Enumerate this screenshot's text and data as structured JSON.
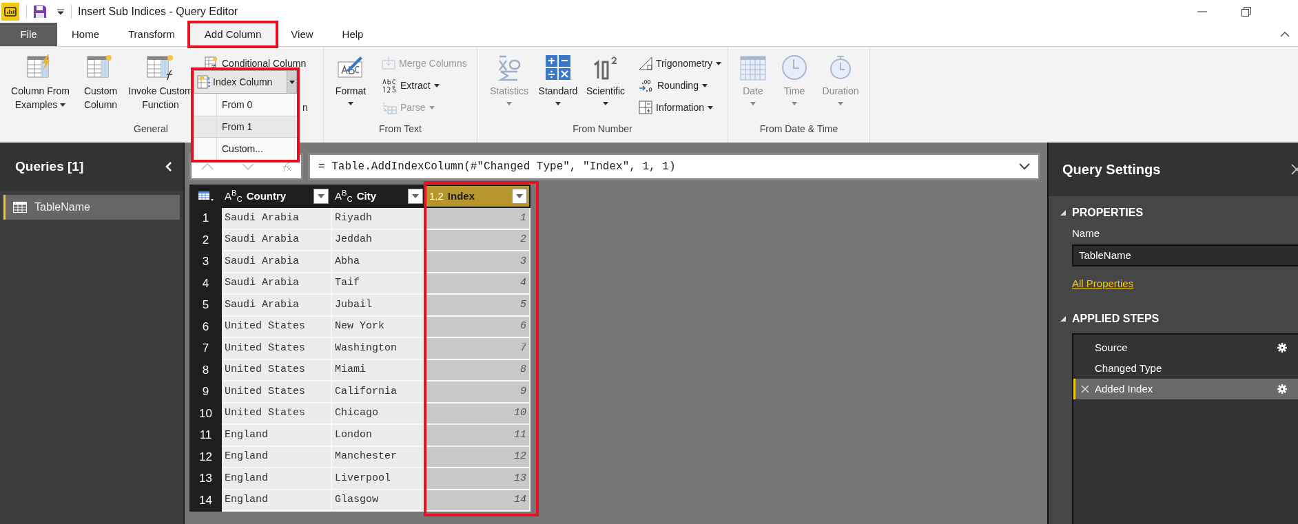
{
  "window": {
    "title": "Insert Sub Indices - Query Editor"
  },
  "tabs": [
    {
      "label": "File",
      "kind": "file",
      "selected": false,
      "highlighted": false
    },
    {
      "label": "Home",
      "kind": "tab",
      "selected": false,
      "highlighted": false
    },
    {
      "label": "Transform",
      "kind": "tab",
      "selected": false,
      "highlighted": false
    },
    {
      "label": "Add Column",
      "kind": "tab",
      "selected": true,
      "highlighted": true
    },
    {
      "label": "View",
      "kind": "tab",
      "selected": false,
      "highlighted": false
    },
    {
      "label": "Help",
      "kind": "tab",
      "selected": false,
      "highlighted": false
    }
  ],
  "ribbon_groups": [
    {
      "label": "General",
      "items": [
        {
          "kind": "large",
          "lines": [
            "Column From",
            "Examples"
          ],
          "dropdown": true,
          "disabled": false
        },
        {
          "kind": "large",
          "lines": [
            "Custom",
            "Column"
          ],
          "dropdown": false,
          "disabled": false
        },
        {
          "kind": "large",
          "lines": [
            "Invoke Custom",
            "Function"
          ],
          "dropdown": false,
          "disabled": false
        },
        {
          "kind": "stack",
          "rows": [
            {
              "label": "Conditional Column",
              "dropdown": false,
              "disabled": false
            },
            {
              "label": "n",
              "dropdown": false,
              "disabled": false
            }
          ]
        }
      ]
    },
    {
      "label": "From Text",
      "items": [
        {
          "kind": "large",
          "lines": [
            "Format"
          ],
          "dropdown": true,
          "disabled": false
        },
        {
          "kind": "stack",
          "rows": [
            {
              "label": "Merge Columns",
              "dropdown": false,
              "disabled": true
            },
            {
              "label": "Extract",
              "dropdown": true,
              "disabled": false
            },
            {
              "label": "Parse",
              "dropdown": true,
              "disabled": true
            }
          ]
        }
      ]
    },
    {
      "label": "From Number",
      "items": [
        {
          "kind": "large",
          "lines": [
            "Statistics"
          ],
          "dropdown": true,
          "disabled": true
        },
        {
          "kind": "large",
          "lines": [
            "Standard"
          ],
          "dropdown": true,
          "disabled": false
        },
        {
          "kind": "large",
          "lines": [
            "Scientific"
          ],
          "dropdown": true,
          "disabled": false
        },
        {
          "kind": "stack",
          "rows": [
            {
              "label": "Trigonometry",
              "dropdown": true,
              "disabled": false
            },
            {
              "label": "Rounding",
              "dropdown": true,
              "disabled": false
            },
            {
              "label": "Information",
              "dropdown": true,
              "disabled": false
            }
          ]
        }
      ]
    },
    {
      "label": "From Date & Time",
      "items": [
        {
          "kind": "large",
          "lines": [
            "Date"
          ],
          "dropdown": true,
          "disabled": true
        },
        {
          "kind": "large",
          "lines": [
            "Time"
          ],
          "dropdown": true,
          "disabled": true
        },
        {
          "kind": "large",
          "lines": [
            "Duration"
          ],
          "dropdown": true,
          "disabled": true
        }
      ]
    }
  ],
  "index_column_menu": {
    "label": "Index Column",
    "expanded": true,
    "highlighted": true,
    "options": [
      {
        "label": "From 0",
        "selected": false
      },
      {
        "label": "From 1",
        "selected": true
      },
      {
        "label": "Custom...",
        "selected": false
      }
    ]
  },
  "queries": {
    "title": "Queries [1]",
    "items": [
      {
        "label": "TableName",
        "selected": true
      }
    ]
  },
  "formula_bar": {
    "formula": "= Table.AddIndexColumn(#\"Changed Type\", \"Index\", 1, 1)"
  },
  "table": {
    "columns": [
      {
        "name": "Country",
        "type_icon": "A$^{B}$$_{C}$",
        "selected": false,
        "highlighted": false
      },
      {
        "name": "City",
        "type_icon": "A$^{B}$$_{C}$",
        "selected": false,
        "highlighted": false
      },
      {
        "name": "Index",
        "type_icon": "1.2",
        "selected": true,
        "highlighted": true
      }
    ],
    "rows": [
      {
        "number": "1",
        "cells": [
          "Saudi Arabia",
          "Riyadh",
          "1"
        ]
      },
      {
        "number": "2",
        "cells": [
          "Saudi Arabia",
          "Jeddah",
          "2"
        ]
      },
      {
        "number": "3",
        "cells": [
          "Saudi Arabia",
          "Abha",
          "3"
        ]
      },
      {
        "number": "4",
        "cells": [
          "Saudi Arabia",
          "Taif",
          "4"
        ]
      },
      {
        "number": "5",
        "cells": [
          "Saudi Arabia",
          "Jubail",
          "5"
        ]
      },
      {
        "number": "6",
        "cells": [
          "United States",
          "New York",
          "6"
        ]
      },
      {
        "number": "7",
        "cells": [
          "United States",
          "Washington",
          "7"
        ]
      },
      {
        "number": "8",
        "cells": [
          "United States",
          "Miami",
          "8"
        ]
      },
      {
        "number": "9",
        "cells": [
          "United States",
          "California",
          "9"
        ]
      },
      {
        "number": "10",
        "cells": [
          "United States",
          "Chicago",
          "10"
        ]
      },
      {
        "number": "11",
        "cells": [
          "England",
          "London",
          "11"
        ]
      },
      {
        "number": "12",
        "cells": [
          "England",
          "Manchester",
          "12"
        ]
      },
      {
        "number": "13",
        "cells": [
          "England",
          "Liverpool",
          "13"
        ]
      },
      {
        "number": "14",
        "cells": [
          "England",
          "Glasgow",
          "14"
        ]
      }
    ]
  },
  "query_settings": {
    "title": "Query Settings",
    "properties": {
      "heading": "PROPERTIES",
      "expanded": true,
      "name_label": "Name",
      "name_value": "TableName",
      "link": "All Properties"
    },
    "applied_steps": {
      "heading": "APPLIED STEPS",
      "expanded": true,
      "steps": [
        {
          "label": "Source",
          "has_settings": true,
          "selected": false
        },
        {
          "label": "Changed Type",
          "has_settings": false,
          "selected": false
        },
        {
          "label": "Added Index",
          "has_settings": true,
          "selected": true
        }
      ]
    }
  }
}
